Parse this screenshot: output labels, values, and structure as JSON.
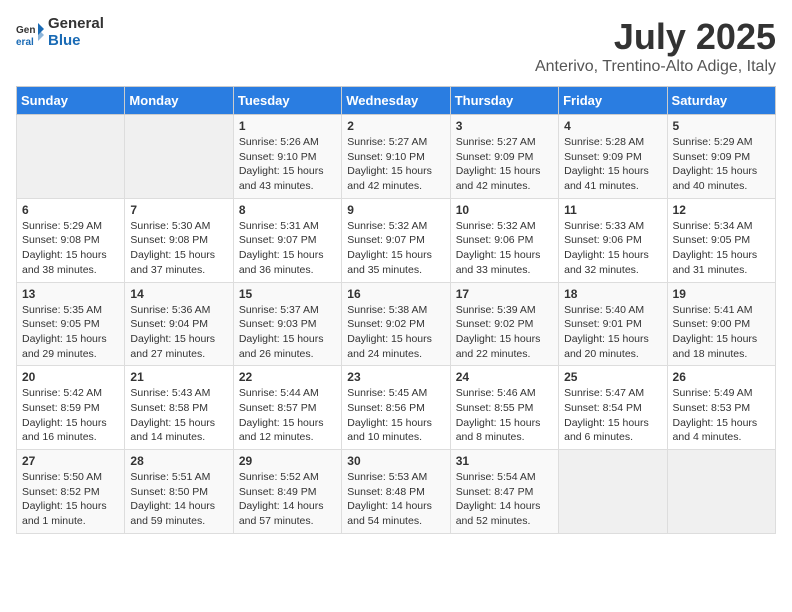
{
  "logo": {
    "general": "General",
    "blue": "Blue"
  },
  "title": "July 2025",
  "subtitle": "Anterivo, Trentino-Alto Adige, Italy",
  "weekdays": [
    "Sunday",
    "Monday",
    "Tuesday",
    "Wednesday",
    "Thursday",
    "Friday",
    "Saturday"
  ],
  "weeks": [
    [
      {
        "day": "",
        "sunrise": "",
        "sunset": "",
        "daylight": ""
      },
      {
        "day": "",
        "sunrise": "",
        "sunset": "",
        "daylight": ""
      },
      {
        "day": "1",
        "sunrise": "Sunrise: 5:26 AM",
        "sunset": "Sunset: 9:10 PM",
        "daylight": "Daylight: 15 hours and 43 minutes."
      },
      {
        "day": "2",
        "sunrise": "Sunrise: 5:27 AM",
        "sunset": "Sunset: 9:10 PM",
        "daylight": "Daylight: 15 hours and 42 minutes."
      },
      {
        "day": "3",
        "sunrise": "Sunrise: 5:27 AM",
        "sunset": "Sunset: 9:09 PM",
        "daylight": "Daylight: 15 hours and 42 minutes."
      },
      {
        "day": "4",
        "sunrise": "Sunrise: 5:28 AM",
        "sunset": "Sunset: 9:09 PM",
        "daylight": "Daylight: 15 hours and 41 minutes."
      },
      {
        "day": "5",
        "sunrise": "Sunrise: 5:29 AM",
        "sunset": "Sunset: 9:09 PM",
        "daylight": "Daylight: 15 hours and 40 minutes."
      }
    ],
    [
      {
        "day": "6",
        "sunrise": "Sunrise: 5:29 AM",
        "sunset": "Sunset: 9:08 PM",
        "daylight": "Daylight: 15 hours and 38 minutes."
      },
      {
        "day": "7",
        "sunrise": "Sunrise: 5:30 AM",
        "sunset": "Sunset: 9:08 PM",
        "daylight": "Daylight: 15 hours and 37 minutes."
      },
      {
        "day": "8",
        "sunrise": "Sunrise: 5:31 AM",
        "sunset": "Sunset: 9:07 PM",
        "daylight": "Daylight: 15 hours and 36 minutes."
      },
      {
        "day": "9",
        "sunrise": "Sunrise: 5:32 AM",
        "sunset": "Sunset: 9:07 PM",
        "daylight": "Daylight: 15 hours and 35 minutes."
      },
      {
        "day": "10",
        "sunrise": "Sunrise: 5:32 AM",
        "sunset": "Sunset: 9:06 PM",
        "daylight": "Daylight: 15 hours and 33 minutes."
      },
      {
        "day": "11",
        "sunrise": "Sunrise: 5:33 AM",
        "sunset": "Sunset: 9:06 PM",
        "daylight": "Daylight: 15 hours and 32 minutes."
      },
      {
        "day": "12",
        "sunrise": "Sunrise: 5:34 AM",
        "sunset": "Sunset: 9:05 PM",
        "daylight": "Daylight: 15 hours and 31 minutes."
      }
    ],
    [
      {
        "day": "13",
        "sunrise": "Sunrise: 5:35 AM",
        "sunset": "Sunset: 9:05 PM",
        "daylight": "Daylight: 15 hours and 29 minutes."
      },
      {
        "day": "14",
        "sunrise": "Sunrise: 5:36 AM",
        "sunset": "Sunset: 9:04 PM",
        "daylight": "Daylight: 15 hours and 27 minutes."
      },
      {
        "day": "15",
        "sunrise": "Sunrise: 5:37 AM",
        "sunset": "Sunset: 9:03 PM",
        "daylight": "Daylight: 15 hours and 26 minutes."
      },
      {
        "day": "16",
        "sunrise": "Sunrise: 5:38 AM",
        "sunset": "Sunset: 9:02 PM",
        "daylight": "Daylight: 15 hours and 24 minutes."
      },
      {
        "day": "17",
        "sunrise": "Sunrise: 5:39 AM",
        "sunset": "Sunset: 9:02 PM",
        "daylight": "Daylight: 15 hours and 22 minutes."
      },
      {
        "day": "18",
        "sunrise": "Sunrise: 5:40 AM",
        "sunset": "Sunset: 9:01 PM",
        "daylight": "Daylight: 15 hours and 20 minutes."
      },
      {
        "day": "19",
        "sunrise": "Sunrise: 5:41 AM",
        "sunset": "Sunset: 9:00 PM",
        "daylight": "Daylight: 15 hours and 18 minutes."
      }
    ],
    [
      {
        "day": "20",
        "sunrise": "Sunrise: 5:42 AM",
        "sunset": "Sunset: 8:59 PM",
        "daylight": "Daylight: 15 hours and 16 minutes."
      },
      {
        "day": "21",
        "sunrise": "Sunrise: 5:43 AM",
        "sunset": "Sunset: 8:58 PM",
        "daylight": "Daylight: 15 hours and 14 minutes."
      },
      {
        "day": "22",
        "sunrise": "Sunrise: 5:44 AM",
        "sunset": "Sunset: 8:57 PM",
        "daylight": "Daylight: 15 hours and 12 minutes."
      },
      {
        "day": "23",
        "sunrise": "Sunrise: 5:45 AM",
        "sunset": "Sunset: 8:56 PM",
        "daylight": "Daylight: 15 hours and 10 minutes."
      },
      {
        "day": "24",
        "sunrise": "Sunrise: 5:46 AM",
        "sunset": "Sunset: 8:55 PM",
        "daylight": "Daylight: 15 hours and 8 minutes."
      },
      {
        "day": "25",
        "sunrise": "Sunrise: 5:47 AM",
        "sunset": "Sunset: 8:54 PM",
        "daylight": "Daylight: 15 hours and 6 minutes."
      },
      {
        "day": "26",
        "sunrise": "Sunrise: 5:49 AM",
        "sunset": "Sunset: 8:53 PM",
        "daylight": "Daylight: 15 hours and 4 minutes."
      }
    ],
    [
      {
        "day": "27",
        "sunrise": "Sunrise: 5:50 AM",
        "sunset": "Sunset: 8:52 PM",
        "daylight": "Daylight: 15 hours and 1 minute."
      },
      {
        "day": "28",
        "sunrise": "Sunrise: 5:51 AM",
        "sunset": "Sunset: 8:50 PM",
        "daylight": "Daylight: 14 hours and 59 minutes."
      },
      {
        "day": "29",
        "sunrise": "Sunrise: 5:52 AM",
        "sunset": "Sunset: 8:49 PM",
        "daylight": "Daylight: 14 hours and 57 minutes."
      },
      {
        "day": "30",
        "sunrise": "Sunrise: 5:53 AM",
        "sunset": "Sunset: 8:48 PM",
        "daylight": "Daylight: 14 hours and 54 minutes."
      },
      {
        "day": "31",
        "sunrise": "Sunrise: 5:54 AM",
        "sunset": "Sunset: 8:47 PM",
        "daylight": "Daylight: 14 hours and 52 minutes."
      },
      {
        "day": "",
        "sunrise": "",
        "sunset": "",
        "daylight": ""
      },
      {
        "day": "",
        "sunrise": "",
        "sunset": "",
        "daylight": ""
      }
    ]
  ]
}
